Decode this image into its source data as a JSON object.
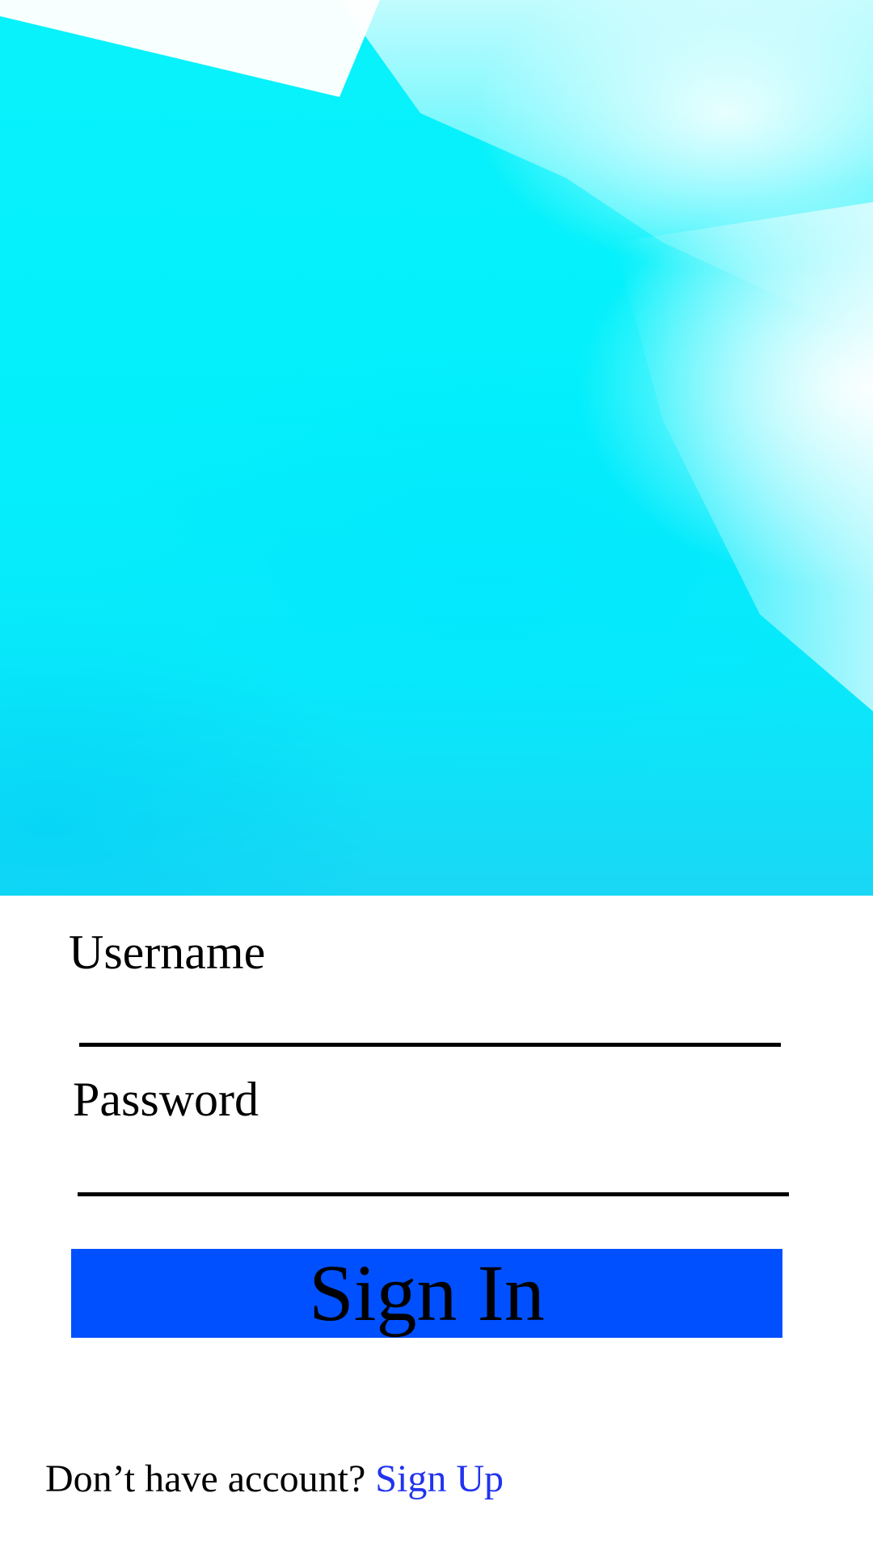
{
  "colors": {
    "hero_main": "#03f0fb",
    "hero_light": "#ffffff",
    "button_bg": "#0050ff",
    "button_text": "#000000",
    "link": "#2233ee",
    "text": "#000000"
  },
  "form": {
    "username_label": "Username",
    "username_value": "",
    "password_label": "Password",
    "password_value": "",
    "signin_label": "Sign In"
  },
  "footer": {
    "prompt": "Don’t have account?",
    "signup_label": "Sign Up"
  }
}
